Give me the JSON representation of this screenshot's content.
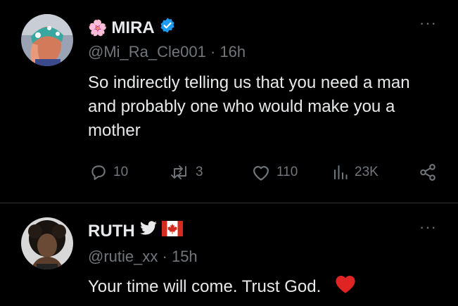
{
  "tweets": [
    {
      "flower_emoji": "🌸",
      "name": "MIRA",
      "handle": "@Mi_Ra_Cle001",
      "time": "16h",
      "text": "So indirectly telling us that you need a man and probably one who would make you a mother",
      "replies": "10",
      "retweets": "3",
      "likes": "110",
      "views": "23K",
      "verified_color": "#1d9bf0"
    },
    {
      "name": "RUTH",
      "handle": "@rutie_xx",
      "time": "15h",
      "text": "Your time will come. Trust God.",
      "heart_color": "#e02424"
    }
  ],
  "more_label": "···",
  "separator": "·",
  "colors": {
    "background": "#000000",
    "primary_text": "#e7e9ea",
    "secondary_text": "#71767b",
    "divider": "#2f3336"
  }
}
